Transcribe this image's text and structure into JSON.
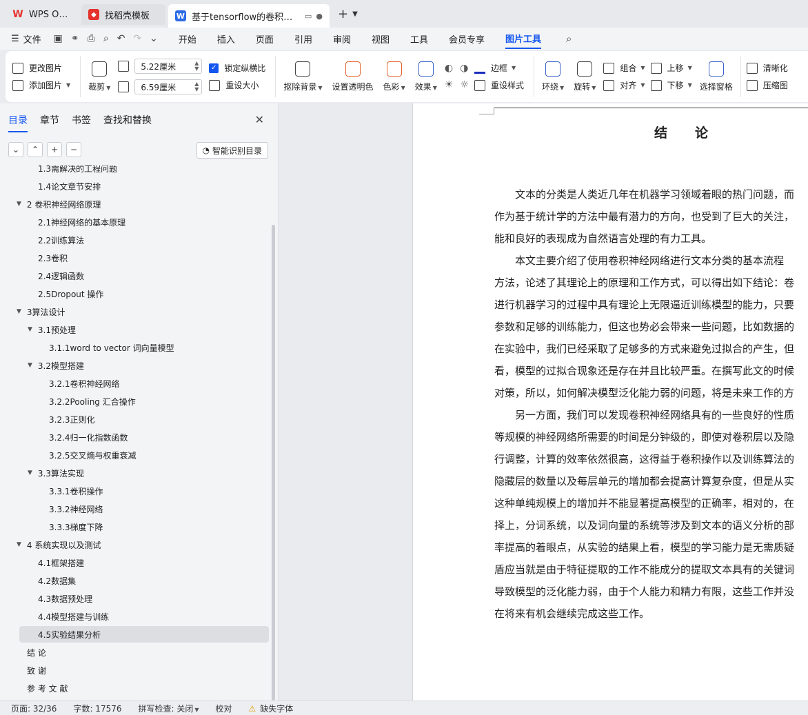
{
  "titlebar": {
    "tabs": [
      {
        "label": "WPS Office"
      },
      {
        "label": "找稻壳模板"
      },
      {
        "label": "基于tensorflow的卷积神经网"
      }
    ]
  },
  "menubar": {
    "file": "文件",
    "items": [
      "开始",
      "插入",
      "页面",
      "引用",
      "审阅",
      "视图",
      "工具",
      "会员专享",
      "图片工具"
    ],
    "active": "图片工具"
  },
  "ribbon": {
    "change_picture": "更改图片",
    "add_picture": "添加图片",
    "crop": "裁剪",
    "width_value": "5.22厘米",
    "height_value": "6.59厘米",
    "lock_ratio": "锁定纵横比",
    "reset_size": "重设大小",
    "remove_bg": "抠除背景",
    "set_transparent": "设置透明色",
    "color": "色彩",
    "effect": "效果",
    "border": "边框",
    "reset_style": "重设样式",
    "wrap": "环绕",
    "rotate": "旋转",
    "group": "组合",
    "align": "对齐",
    "bring_up": "上移",
    "send_down": "下移",
    "selection_pane": "选择窗格",
    "sharpen": "清晰化",
    "compress": "压缩图"
  },
  "panel": {
    "tabs": [
      "目录",
      "章节",
      "书签",
      "查找和替换"
    ],
    "smart_toc": "智能识别目录",
    "toc": [
      {
        "label": "1.3需解决的工程问题",
        "level": 2
      },
      {
        "label": "1.4论文章节安排",
        "level": 2
      },
      {
        "label": "2  卷积神经网络原理",
        "level": 1,
        "expanded": true
      },
      {
        "label": "2.1神经网络的基本原理",
        "level": 2
      },
      {
        "label": "2.2训练算法",
        "level": 2
      },
      {
        "label": "2.3卷积",
        "level": 2
      },
      {
        "label": "2.4逻辑函数",
        "level": 2
      },
      {
        "label": "2.5Dropout 操作",
        "level": 2
      },
      {
        "label": "3算法设计",
        "level": 1,
        "expanded": true
      },
      {
        "label": "3.1预处理",
        "level": 2,
        "expanded": true
      },
      {
        "label": "3.1.1word to vector 词向量模型",
        "level": 3
      },
      {
        "label": "3.2模型搭建",
        "level": 2,
        "expanded": true
      },
      {
        "label": "3.2.1卷积神经网络",
        "level": 3
      },
      {
        "label": "3.2.2Pooling 汇合操作",
        "level": 3
      },
      {
        "label": "3.2.3正则化",
        "level": 3
      },
      {
        "label": "3.2.4归一化指数函数",
        "level": 3
      },
      {
        "label": "3.2.5交叉熵与权重衰减",
        "level": 3
      },
      {
        "label": "3.3算法实现",
        "level": 2,
        "expanded": true
      },
      {
        "label": "3.3.1卷积操作",
        "level": 3
      },
      {
        "label": "3.3.2神经网络",
        "level": 3
      },
      {
        "label": "3.3.3梯度下降",
        "level": 3
      },
      {
        "label": "4  系统实现以及测试",
        "level": 1,
        "expanded": true
      },
      {
        "label": "4.1框架搭建",
        "level": 2
      },
      {
        "label": "4.2数据集",
        "level": 2
      },
      {
        "label": "4.3数据预处理",
        "level": 2
      },
      {
        "label": "4.4模型搭建与训练",
        "level": 2
      },
      {
        "label": "4.5实验结果分析",
        "level": 2,
        "selected": true
      },
      {
        "label": "结  论",
        "level": 1
      },
      {
        "label": "致  谢",
        "level": 1
      },
      {
        "label": "参 考 文 献",
        "level": 1
      }
    ]
  },
  "document": {
    "heading": "结论",
    "lines": [
      "　　文本的分类是人类近几年在机器学习领域着眼的热门问题，而",
      "作为基于统计学的方法中最有潜力的方向，也受到了巨大的关注，",
      "能和良好的表现成为自然语言处理的有力工具。",
      "　　本文主要介绍了使用卷积神经网络进行文本分类的基本流程",
      "方法，论述了其理论上的原理和工作方式，可以得出如下结论：卷",
      "进行机器学习的过程中具有理论上无限逼近训练模型的能力，只要",
      "参数和足够的训练能力，但这也势必会带来一些问题，比如数据的",
      "在实验中，我们已经采取了足够多的方式来避免过拟合的产生，但",
      "看，模型的过拟合现象还是存在并且比较严重。在撰写此文的时候",
      "对策，所以，如何解决模型泛化能力弱的问题，将是未来工作的方",
      "　　另一方面，我们可以发现卷积神经网络具有的一些良好的性质",
      "等规模的神经网络所需要的时间是分钟级的，即使对卷积层以及隐",
      "行调整，计算的效率依然很高，这得益于卷积操作以及训练算法的",
      "隐藏层的数量以及每层单元的增加都会提高计算复杂度，但是从实",
      "这种单纯规模上的增加并不能显著提高模型的正确率，相对的，在",
      "择上，分词系统，以及词向量的系统等涉及到文本的语义分析的部",
      "率提高的着眼点，从实验的结果上看，模型的学习能力是无需质疑",
      "盾应当就是由于特征提取的工作不能成分的提取文本具有的关键词",
      "导致模型的泛化能力弱，由于个人能力和精力有限，这些工作并没",
      "在将来有机会继续完成这些工作。"
    ]
  },
  "statusbar": {
    "page": "页面: 32/36",
    "words": "字数: 17576",
    "spell": "拼写检查: 关闭",
    "proof": "校对",
    "missing_font": "缺失字体"
  }
}
